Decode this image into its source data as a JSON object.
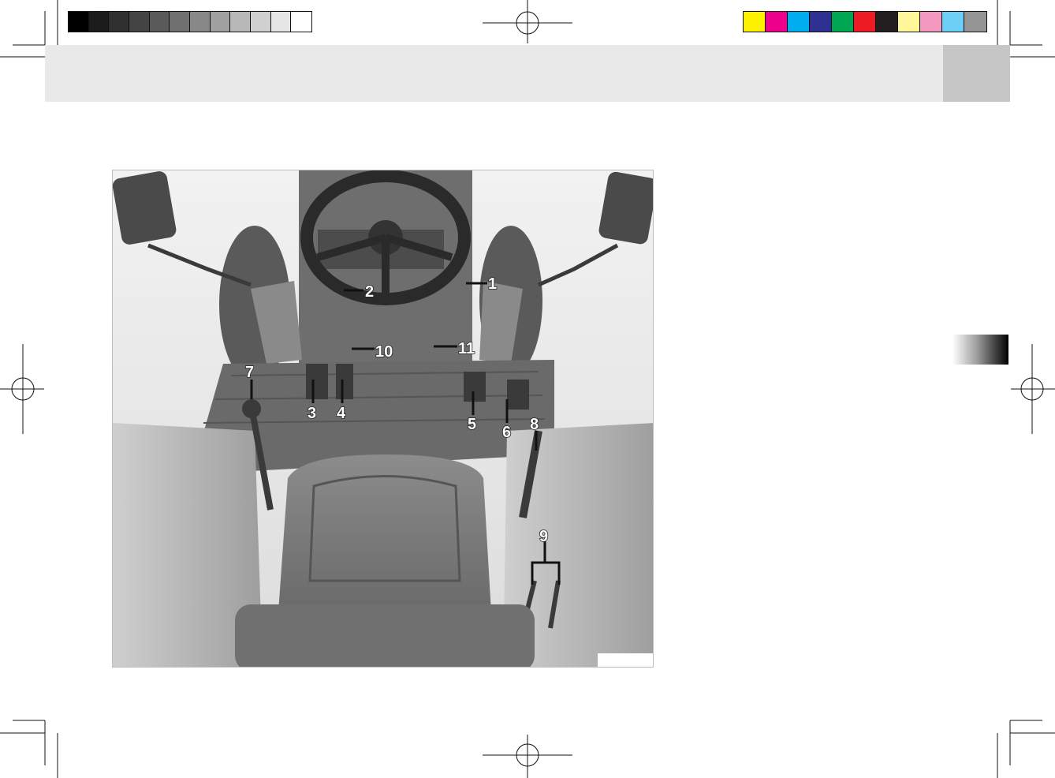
{
  "color_bar": {
    "gray_swatches": [
      "#000000",
      "#1c1c1c",
      "#303030",
      "#444444",
      "#5a5a5a",
      "#707070",
      "#888888",
      "#a0a0a0",
      "#b8b8b8",
      "#d0d0d0",
      "#e6e6e6",
      "#ffffff"
    ],
    "color_swatches": [
      "#fff200",
      "#ec008c",
      "#00aeef",
      "#2e3192",
      "#00a651",
      "#ed1c24",
      "#231f20",
      "#fff799",
      "#f49ac1",
      "#6dcff6",
      "#959595"
    ]
  },
  "figure": {
    "callouts": [
      "1",
      "2",
      "3",
      "4",
      "5",
      "6",
      "7",
      "8",
      "9",
      "10",
      "11"
    ]
  }
}
